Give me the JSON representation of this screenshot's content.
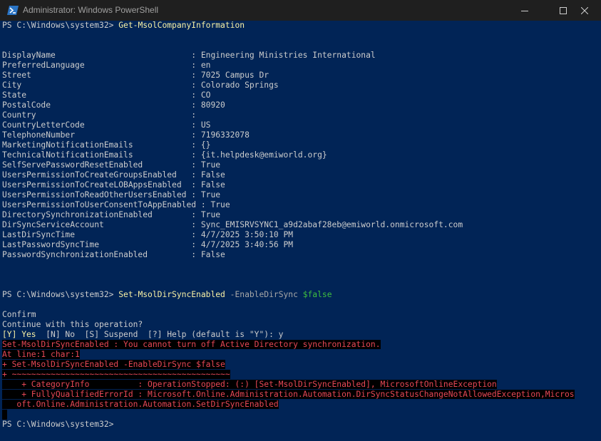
{
  "window": {
    "title": "Administrator: Windows PowerShell",
    "icon": "powershell-icon",
    "controls": {
      "minimize": "minimize-icon",
      "maximize": "maximize-icon",
      "close": "close-icon"
    }
  },
  "colors": {
    "background": "#012456",
    "text": "#cccccc",
    "command": "#f9f1a5",
    "parameter": "#a7a7a7",
    "variable": "#3fbf3f",
    "error_fg": "#e74856",
    "error_bg": "#000000"
  },
  "console": {
    "prompt1": "PS C:\\Windows\\system32> ",
    "command1": "Get-MsolCompanyInformation",
    "properties": [
      {
        "line": "DisplayName                            : Engineering Ministries International"
      },
      {
        "line": "PreferredLanguage                      : en"
      },
      {
        "line": "Street                                 : 7025 Campus Dr"
      },
      {
        "line": "City                                   : Colorado Springs"
      },
      {
        "line": "State                                  : CO"
      },
      {
        "line": "PostalCode                             : 80920"
      },
      {
        "line": "Country                                :"
      },
      {
        "line": "CountryLetterCode                      : US"
      },
      {
        "line": "TelephoneNumber                        : 7196332078"
      },
      {
        "line": "MarketingNotificationEmails            : {}"
      },
      {
        "line": "TechnicalNotificationEmails            : {it.helpdesk@emiworld.org}"
      },
      {
        "line": "SelfServePasswordResetEnabled          : True"
      },
      {
        "line": "UsersPermissionToCreateGroupsEnabled   : False"
      },
      {
        "line": "UsersPermissionToCreateLOBAppsEnabled  : False"
      },
      {
        "line": "UsersPermissionToReadOtherUsersEnabled : True"
      },
      {
        "line": "UsersPermissionToUserConsentToAppEnabled : True"
      },
      {
        "line": "DirectorySynchronizationEnabled        : True"
      },
      {
        "line": "DirSyncServiceAccount                  : Sync_EMISRVSYNC1_a9d2abaf28eb@emiworld.onmicrosoft.com"
      },
      {
        "line": "LastDirSyncTime                        : 4/7/2025 3:50:10 PM"
      },
      {
        "line": "LastPasswordSyncTime                   : 4/7/2025 3:40:56 PM"
      },
      {
        "line": "PasswordSynchronizationEnabled         : False"
      }
    ],
    "prompt2": "PS C:\\Windows\\system32> ",
    "command2": "Set-MsolDirSyncEnabled",
    "param2": " -EnableDirSync ",
    "value2": "$false",
    "confirm": "Confirm",
    "confirm_question": "Continue with this operation?",
    "choice_yes": "[Y] Yes",
    "choice_rest": "  [N] No  [S] Suspend  [?] Help (default is \"Y\"): y",
    "errors": [
      "Set-MsolDirSyncEnabled : You cannot turn off Active Directory synchronization.",
      "At line:1 char:1",
      "+ Set-MsolDirSyncEnabled -EnableDirSync $false",
      "+ ~~~~~~~~~~~~~~~~~~~~~~~~~~~~~~~~~~~~~~~~~~~~~",
      "    + CategoryInfo          : OperationStopped: (:) [Set-MsolDirSyncEnabled], MicrosoftOnlineException",
      "    + FullyQualifiedErrorId : Microsoft.Online.Administration.Automation.DirSyncStatusChangeNotAllowedException,Micros",
      "   oft.Online.Administration.Automation.SetDirSyncEnabled"
    ],
    "prompt3": "PS C:\\Windows\\system32> "
  }
}
